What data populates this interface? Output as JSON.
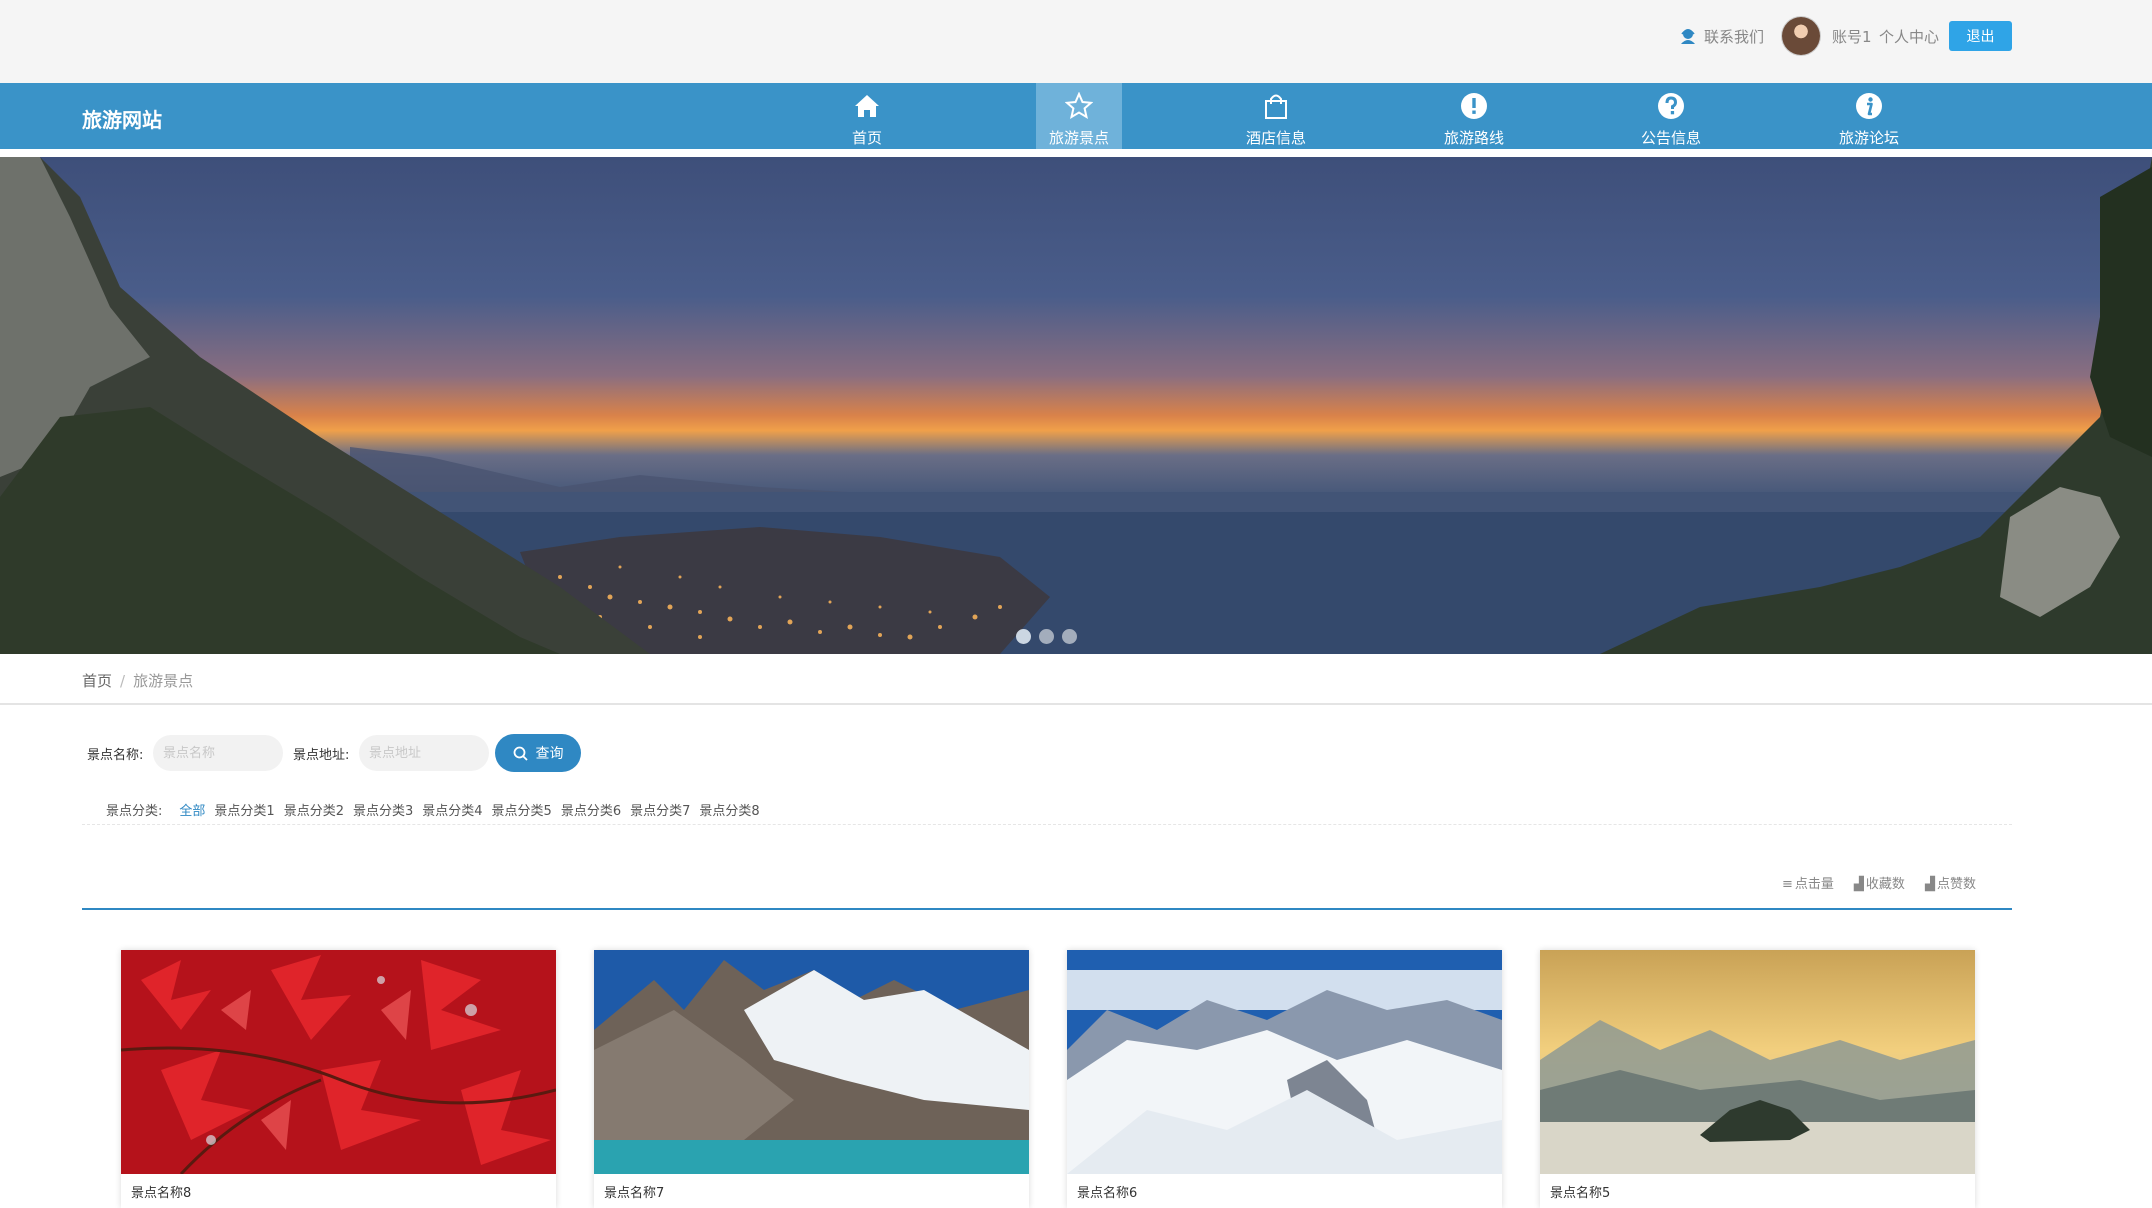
{
  "topbar": {
    "contact_label": "联系我们",
    "account_label": "账号1",
    "center_label": "个人中心",
    "logout_label": "退出"
  },
  "nav": {
    "brand": "旅游网站",
    "items": [
      {
        "label": "首页",
        "icon": "home-icon"
      },
      {
        "label": "旅游景点",
        "icon": "star-icon",
        "active": true
      },
      {
        "label": "酒店信息",
        "icon": "shopping-bag-icon"
      },
      {
        "label": "旅游路线",
        "icon": "exclamation-icon"
      },
      {
        "label": "公告信息",
        "icon": "question-icon"
      },
      {
        "label": "旅游论坛",
        "icon": "info-icon"
      }
    ]
  },
  "breadcrumb": {
    "home": "首页",
    "separator": "/",
    "current": "旅游景点"
  },
  "search": {
    "name_label": "景点名称:",
    "name_placeholder": "景点名称",
    "address_label": "景点地址:",
    "address_placeholder": "景点地址",
    "query_label": "查询"
  },
  "categories": {
    "label": "景点分类:",
    "items": [
      "全部",
      "景点分类1",
      "景点分类2",
      "景点分类3",
      "景点分类4",
      "景点分类5",
      "景点分类6",
      "景点分类7",
      "景点分类8"
    ]
  },
  "sort": {
    "clicks": "点击量",
    "favorites": "收藏数",
    "likes": "点赞数"
  },
  "cards": [
    {
      "title": "景点名称8"
    },
    {
      "title": "景点名称7"
    },
    {
      "title": "景点名称6"
    },
    {
      "title": "景点名称5"
    }
  ],
  "colors": {
    "nav_bg": "#3a93c8",
    "nav_active": "#6fb2da",
    "accent": "#2f88c3",
    "logout_bg": "#2fa4e7",
    "topbar_bg": "#f5f5f5"
  }
}
